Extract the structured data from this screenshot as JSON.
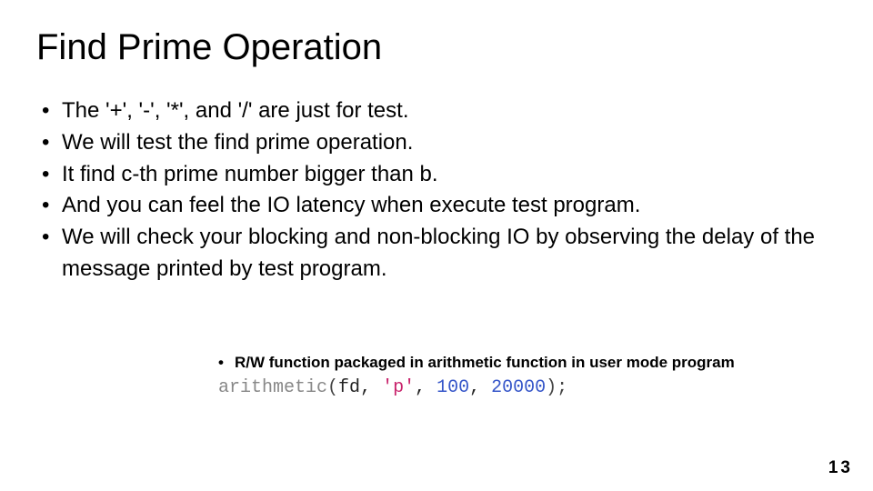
{
  "title": "Find Prime Operation",
  "bullets": [
    "The '+', '-', '*', and '/' are just for test.",
    "We will test the find prime operation.",
    "It find c-th prime number bigger than b.",
    "And you can feel the IO latency when execute test program.",
    "We will check your blocking and non-blocking IO by observing the delay of the message printed by test program."
  ],
  "subnote": "R/W function packaged in arithmetic function in user mode program",
  "code": {
    "fn": "arithmetic",
    "arg0": "fd",
    "arg1": "'p'",
    "arg2": "100",
    "arg3": "20000"
  },
  "page_number": "13"
}
